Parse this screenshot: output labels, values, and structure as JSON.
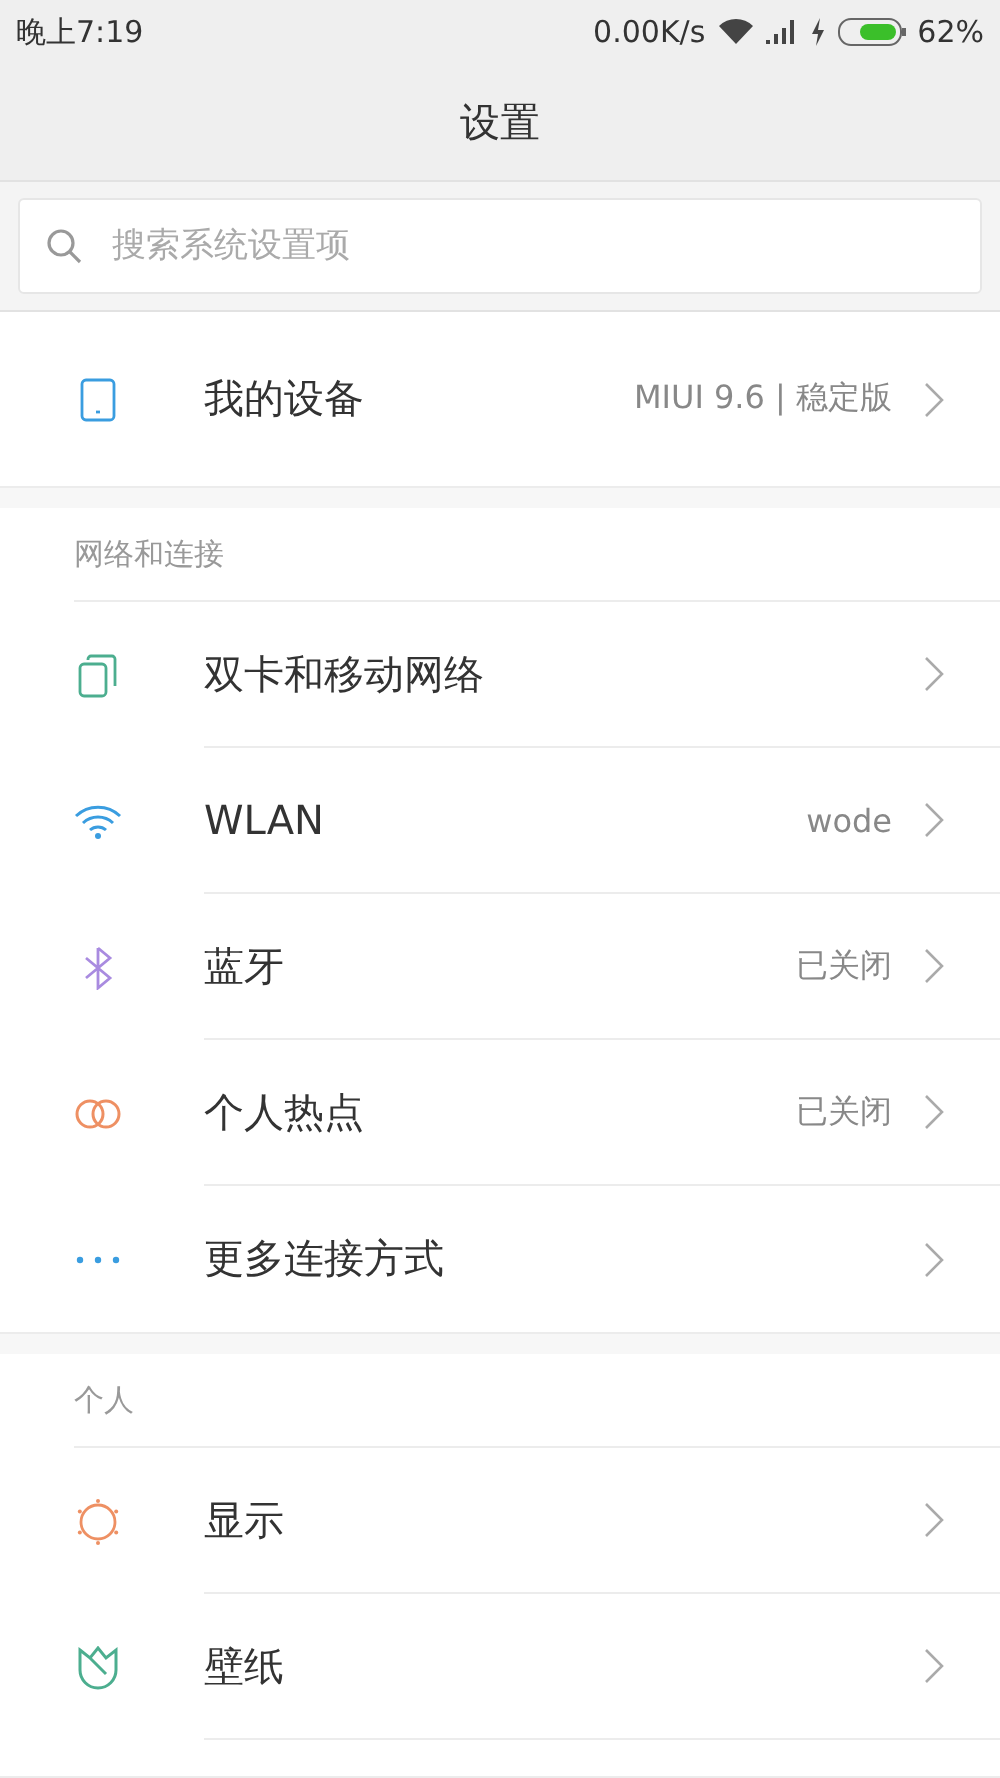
{
  "status_bar": {
    "time": "晚上7:19",
    "net_speed": "0.00K/s",
    "battery": "62%"
  },
  "title": "设置",
  "search": {
    "placeholder": "搜索系统设置项"
  },
  "device": {
    "label": "我的设备",
    "value": "MIUI 9.6 | 稳定版"
  },
  "sections": [
    {
      "header": "网络和连接",
      "items": [
        {
          "label": "双卡和移动网络"
        },
        {
          "label": "WLAN",
          "value": "wode"
        },
        {
          "label": "蓝牙",
          "value": "已关闭"
        },
        {
          "label": "个人热点",
          "value": "已关闭"
        },
        {
          "label": "更多连接方式"
        }
      ]
    },
    {
      "header": "个人",
      "items": [
        {
          "label": "显示"
        },
        {
          "label": "壁纸"
        }
      ]
    }
  ]
}
